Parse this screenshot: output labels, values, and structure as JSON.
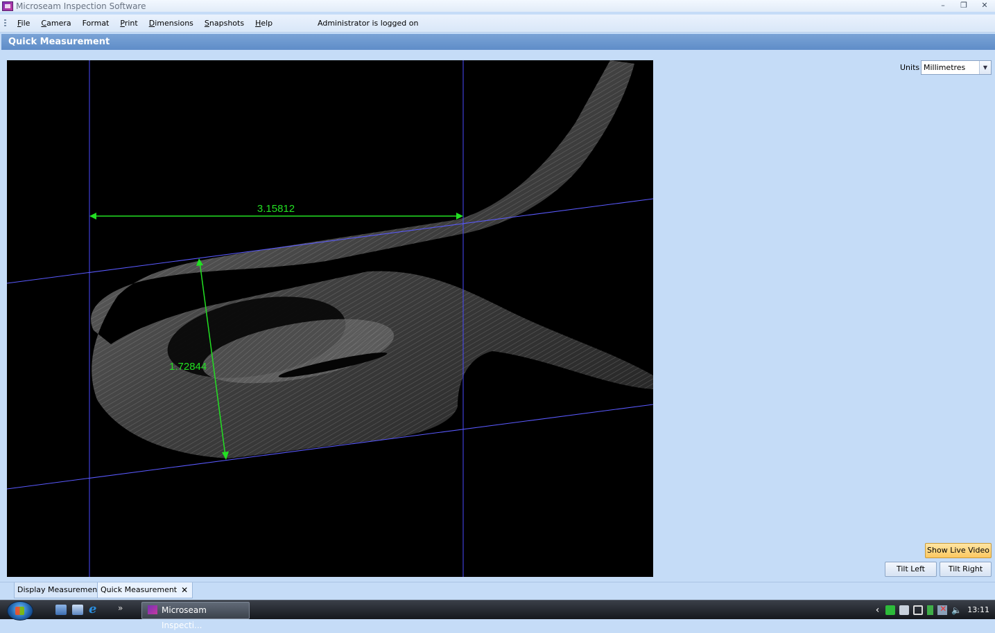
{
  "window": {
    "title": "Microseam Inspection Software",
    "buttons": {
      "minimize": "–",
      "restore": "❐",
      "close": "✕"
    }
  },
  "menu": {
    "items": [
      {
        "first": "F",
        "rest": "ile"
      },
      {
        "first": "C",
        "rest": "amera"
      },
      {
        "first": "F",
        "rest": "ormat"
      },
      {
        "first": "P",
        "rest": "rint"
      },
      {
        "first": "D",
        "rest": "imensions"
      },
      {
        "first": "S",
        "rest": "napshots"
      },
      {
        "first": "H",
        "rest": "elp"
      }
    ],
    "status": "Administrator is logged on"
  },
  "panel": {
    "title": "Quick Measurement"
  },
  "measurements": {
    "horizontal": "3.15812",
    "vertical": "1.72844"
  },
  "units": {
    "label": "Units",
    "selected": "Millimetres"
  },
  "buttons": {
    "show_live_video": "Show Live Video",
    "tilt_left": "Tilt Left",
    "tilt_right": "Tilt Right"
  },
  "tabs": [
    {
      "label": "Display Measurements"
    },
    {
      "label": "Quick Measurement",
      "close": "✕"
    }
  ],
  "taskbar": {
    "task_label": "Microseam Inspecti...",
    "overflow": "»",
    "tray_chevron": "‹",
    "clock": "13:11"
  },
  "colors": {
    "guide_lines": "#4a4aff",
    "measure": "#22e022",
    "accent_button": "#fcc860",
    "header": "#5f8dc8"
  }
}
